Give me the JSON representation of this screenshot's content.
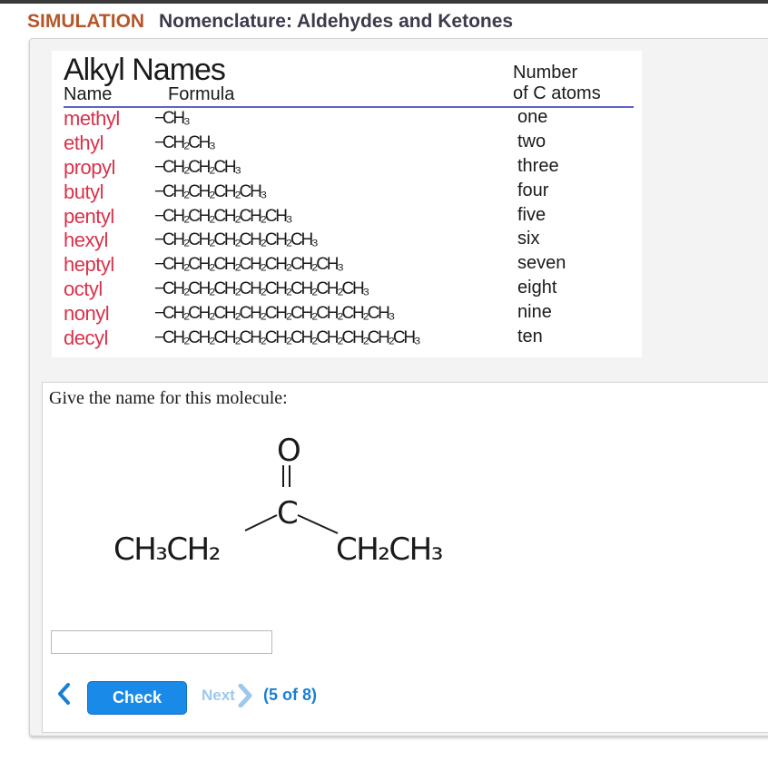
{
  "header": {
    "simulation_label": "SIMULATION",
    "title": "Nomenclature: Aldehydes and Ketones"
  },
  "reference_table": {
    "title": "Alkyl Names",
    "col_name": "Name",
    "col_formula": "Formula",
    "col_number": [
      "Number",
      "of C atoms"
    ],
    "rows": [
      {
        "name": "methyl",
        "formula": "−CH₃",
        "number": "one"
      },
      {
        "name": "ethyl",
        "formula": "−CH₂CH₃",
        "number": "two"
      },
      {
        "name": "propyl",
        "formula": "−CH₂CH₂CH₃",
        "number": "three"
      },
      {
        "name": "butyl",
        "formula": "−CH₂CH₂CH₂CH₃",
        "number": "four"
      },
      {
        "name": "pentyl",
        "formula": "−CH₂CH₂CH₂CH₂CH₃",
        "number": "five"
      },
      {
        "name": "hexyl",
        "formula": "−CH₂CH₂CH₂CH₂CH₂CH₃",
        "number": "six"
      },
      {
        "name": "heptyl",
        "formula": "−CH₂CH₂CH₂CH₂CH₂CH₂CH₃",
        "number": "seven"
      },
      {
        "name": "octyl",
        "formula": "−CH₂CH₂CH₂CH₂CH₂CH₂CH₂CH₃",
        "number": "eight"
      },
      {
        "name": "nonyl",
        "formula": "−CH₂CH₂CH₂CH₂CH₂CH₂CH₂CH₂CH₃",
        "number": "nine"
      },
      {
        "name": "decyl",
        "formula": "−CH₂CH₂CH₂CH₂CH₂CH₂CH₂CH₂CH₂CH₃",
        "number": "ten"
      }
    ]
  },
  "question": {
    "prompt": "Give the name for this molecule:",
    "molecule": {
      "oxygen": "O",
      "carbon": "C",
      "left_group": "CH₃CH₂",
      "right_group": "CH₂CH₃"
    },
    "answer_value": "",
    "answer_placeholder": ""
  },
  "controls": {
    "check_label": "Check",
    "next_label": "Next",
    "progress": "(5 of 8)",
    "prev_icon": "chevron-left-icon",
    "next_icon": "chevron-right-icon"
  },
  "colors": {
    "brand": "#b5562a",
    "name_red": "#d8324a",
    "rule_blue": "#5d63c7",
    "check_blue": "#1a8ae8"
  }
}
